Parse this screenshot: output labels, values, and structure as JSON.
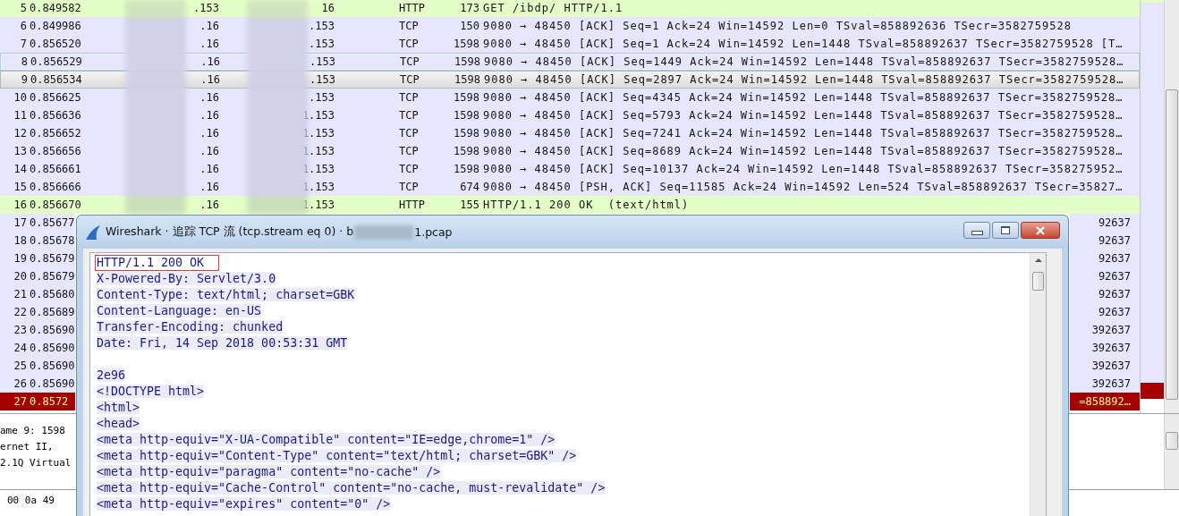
{
  "packet_list": {
    "rows": [
      {
        "no": "5",
        "time": "0.849582",
        "source": ".153",
        "destination": "16",
        "protocol": "HTTP",
        "length": "173",
        "info": "GET /ibdp/ HTTP/1.1",
        "color": "#e4ffc7",
        "selected": false,
        "hovered": false
      },
      {
        "no": "6",
        "time": "0.849986",
        "source": ".16",
        "destination": ".153",
        "protocol": "TCP",
        "length": "150",
        "info": "9080 → 48450 [ACK] Seq=1 Ack=24 Win=14592 Len=0 TSval=858892636 TSecr=3582759528",
        "color": "#e7e6ff",
        "selected": false,
        "hovered": false
      },
      {
        "no": "7",
        "time": "0.856520",
        "source": ".16",
        "destination": ".153",
        "protocol": "TCP",
        "length": "1598",
        "info": "9080 → 48450 [ACK] Seq=1 Ack=24 Win=14592 Len=1448 TSval=858892637 TSecr=3582759528 [T…",
        "color": "#e7e6ff",
        "selected": false,
        "hovered": false
      },
      {
        "no": "8",
        "time": "0.856529",
        "source": ".16",
        "destination": ".153",
        "protocol": "TCP",
        "length": "1598",
        "info": "9080 → 48450 [ACK] Seq=1449 Ack=24 Win=14592 Len=1448 TSval=858892637 TSecr=3582759528…",
        "color": "#e7e6ff",
        "selected": false,
        "hovered": true
      },
      {
        "no": "9",
        "time": "0.856534",
        "source": ".16",
        "destination": ".153",
        "protocol": "TCP",
        "length": "1598",
        "info": "9080 → 48450 [ACK] Seq=2897 Ack=24 Win=14592 Len=1448 TSval=858892637 TSecr=3582759528…",
        "color": "#e7e6ff",
        "selected": true,
        "hovered": false
      },
      {
        "no": "10",
        "time": "0.856625",
        "source": ".16",
        "destination": ".153",
        "protocol": "TCP",
        "length": "1598",
        "info": "9080 → 48450 [ACK] Seq=4345 Ack=24 Win=14592 Len=1448 TSval=858892637 TSecr=3582759528…",
        "color": "#e7e6ff",
        "selected": false,
        "hovered": false
      },
      {
        "no": "11",
        "time": "0.856636",
        "source": ".16",
        "destination": "1.153",
        "protocol": "TCP",
        "length": "1598",
        "info": "9080 → 48450 [ACK] Seq=5793 Ack=24 Win=14592 Len=1448 TSval=858892637 TSecr=3582759528…",
        "color": "#e7e6ff",
        "selected": false,
        "hovered": false
      },
      {
        "no": "12",
        "time": "0.856652",
        "source": ".16",
        "destination": "1.153",
        "protocol": "TCP",
        "length": "1598",
        "info": "9080 → 48450 [ACK] Seq=7241 Ack=24 Win=14592 Len=1448 TSval=858892637 TSecr=3582759528…",
        "color": "#e7e6ff",
        "selected": false,
        "hovered": false
      },
      {
        "no": "13",
        "time": "0.856656",
        "source": ".16",
        "destination": "1.153",
        "protocol": "TCP",
        "length": "1598",
        "info": "9080 → 48450 [ACK] Seq=8689 Ack=24 Win=14592 Len=1448 TSval=858892637 TSecr=3582759528…",
        "color": "#e7e6ff",
        "selected": false,
        "hovered": false
      },
      {
        "no": "14",
        "time": "0.856661",
        "source": ".16",
        "destination": "1.153",
        "protocol": "TCP",
        "length": "1598",
        "info": "9080 → 48450 [ACK] Seq=10137 Ack=24 Win=14592 Len=1448 TSval=858892637 TSecr=358275952…",
        "color": "#e7e6ff",
        "selected": false,
        "hovered": false
      },
      {
        "no": "15",
        "time": "0.856666",
        "source": ".16",
        "destination": "1.153",
        "protocol": "TCP",
        "length": "674",
        "info": "9080 → 48450 [PSH, ACK] Seq=11585 Ack=24 Win=14592 Len=524 TSval=858892637 TSecr=35827…",
        "color": "#e7e6ff",
        "selected": false,
        "hovered": false
      },
      {
        "no": "16",
        "time": "0.856670",
        "source": ".16",
        "destination": "1.153",
        "protocol": "HTTP",
        "length": "155",
        "info": "HTTP/1.1 200 OK  (text/html)",
        "color": "#e4ffc7",
        "selected": false,
        "hovered": false
      },
      {
        "no": "17",
        "time": "0.85677",
        "info_end": "92637",
        "color": "#e7e6ff",
        "selected": false,
        "hovered": false
      },
      {
        "no": "18",
        "time": "0.85678",
        "info_end": "92637",
        "color": "#e7e6ff",
        "selected": false,
        "hovered": false
      },
      {
        "no": "19",
        "time": "0.85679",
        "info_end": "92637",
        "color": "#e7e6ff",
        "selected": false,
        "hovered": false
      },
      {
        "no": "20",
        "time": "0.85679",
        "info_end": "92637",
        "color": "#e7e6ff",
        "selected": false,
        "hovered": false
      },
      {
        "no": "21",
        "time": "0.85680",
        "info_end": "92637",
        "color": "#e7e6ff",
        "selected": false,
        "hovered": false
      },
      {
        "no": "22",
        "time": "0.85689",
        "info_end": "92637",
        "color": "#e7e6ff",
        "selected": false,
        "hovered": false
      },
      {
        "no": "23",
        "time": "0.85690",
        "info_end": "392637",
        "color": "#e7e6ff",
        "selected": false,
        "hovered": false
      },
      {
        "no": "24",
        "time": "0.85690",
        "info_end": "392637",
        "color": "#e7e6ff",
        "selected": false,
        "hovered": false
      },
      {
        "no": "25",
        "time": "0.85690",
        "info_end": "392637",
        "color": "#e7e6ff",
        "selected": false,
        "hovered": false
      },
      {
        "no": "26",
        "time": "0.85690",
        "info_end": "392637",
        "color": "#e7e6ff",
        "selected": false,
        "hovered": false
      },
      {
        "no": "27",
        "time": "0.8572",
        "info_end": "=858892…",
        "color": "#a40000",
        "selected": false,
        "hovered": false
      }
    ]
  },
  "details": {
    "lines": [
      "ame 9: 1598",
      "ernet II, ",
      "2.1Q Virtual"
    ]
  },
  "bytes": {
    "lines": [
      "00 0a 49"
    ]
  },
  "dialog": {
    "title": "Wireshark · 追踪 TCP 流 (tcp.stream eq 0) · b",
    "title_end": "1.pcap",
    "headers": [
      {
        "text": "HTTP/1.1 200 OK",
        "boxed": true
      },
      {
        "text": "X-Powered-By: Servlet/3.0",
        "boxed": false
      },
      {
        "text": "Content-Type: text/html; charset=GBK",
        "boxed": false
      },
      {
        "text": "Content-Language: en-US",
        "boxed": false
      },
      {
        "text": "Transfer-Encoding: chunked",
        "boxed": false
      },
      {
        "text": "Date: Fri, 14 Sep 2018 00:53:31 GMT",
        "boxed": false
      }
    ],
    "body": [
      "2e96",
      "<!DOCTYPE html>",
      "<html>",
      "<head>",
      "<meta http-equiv=\"X-UA-Compatible\" content=\"IE=edge,chrome=1\" />",
      "<meta http-equiv=\"Content-Type\" content=\"text/html; charset=GBK\" />",
      "<meta http-equiv=\"paragma\" content=\"no-cache\" />",
      "<meta http-equiv=\"Cache-Control\" content=\"no-cache, must-revalidate\" />",
      "<meta http-equiv=\"expires\" content=\"0\" />"
    ]
  }
}
